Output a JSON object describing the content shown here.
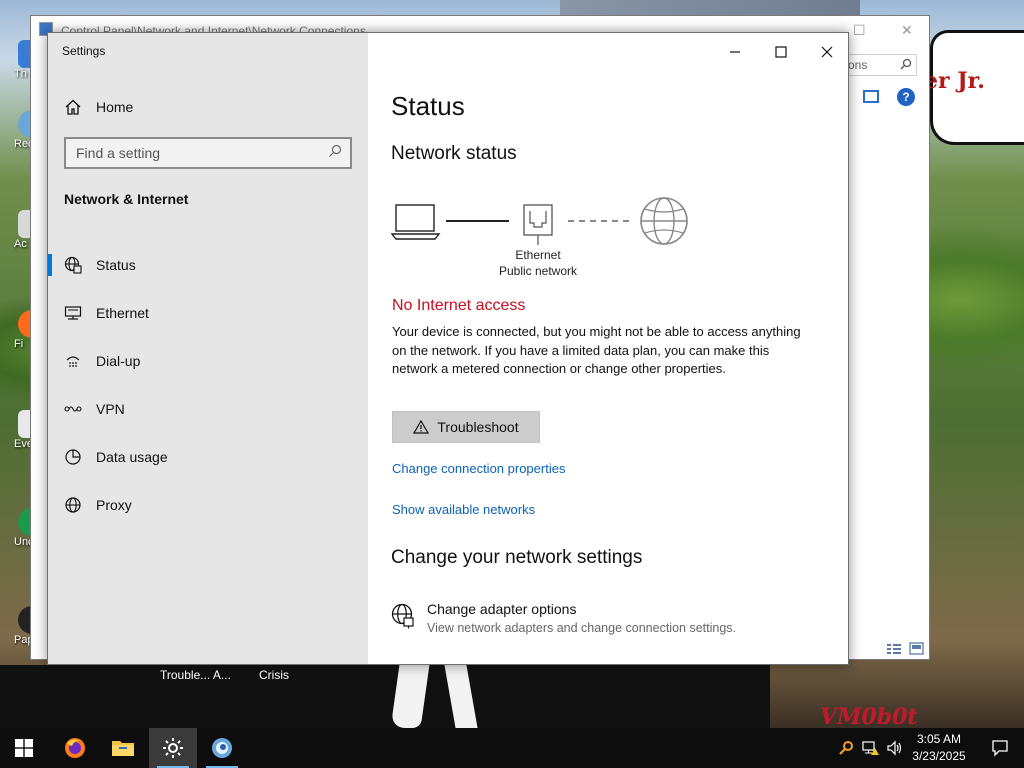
{
  "desktop": {
    "banner_text": "er Jr.",
    "watermark": "VM0b0t",
    "icons": [
      {
        "label": "Th"
      },
      {
        "label": "Rec"
      },
      {
        "label": "Ac"
      },
      {
        "label": "Fi"
      },
      {
        "label": "Eve"
      },
      {
        "label": "Unc"
      },
      {
        "label": "Papers"
      }
    ],
    "bottom_labels": [
      "Trouble... A...",
      "Crisis"
    ]
  },
  "explorer": {
    "title": "Control Panel\\Network and Internet\\Network Connections",
    "search_placeholder": "ctions",
    "help_label": "?"
  },
  "settings": {
    "window_title": "Settings",
    "home_label": "Home",
    "search_placeholder": "Find a setting",
    "section_heading": "Network & Internet",
    "nav_items": [
      {
        "label": "Status",
        "icon": "globe-status-icon",
        "active": true
      },
      {
        "label": "Ethernet",
        "icon": "ethernet-icon"
      },
      {
        "label": "Dial-up",
        "icon": "dial-up-icon"
      },
      {
        "label": "VPN",
        "icon": "vpn-icon"
      },
      {
        "label": "Data usage",
        "icon": "data-usage-icon"
      },
      {
        "label": "Proxy",
        "icon": "proxy-globe-icon"
      }
    ],
    "main": {
      "page_title": "Status",
      "network_status_heading": "Network status",
      "adapter_name": "Ethernet",
      "network_profile": "Public network",
      "alert_title": "No Internet access",
      "alert_body": "Your device is connected, but you might not be able to access anything on the network. If you have a limited data plan, you can make this network a metered connection or change other properties.",
      "troubleshoot_label": "Troubleshoot",
      "link_change_connection": "Change connection properties",
      "link_show_networks": "Show available networks",
      "change_settings_heading": "Change your network settings",
      "adapter_options_title": "Change adapter options",
      "adapter_options_subtitle": "View network adapters and change connection settings."
    }
  },
  "taskbar": {
    "apps": [
      {
        "name": "firefox",
        "icon": "firefox-icon"
      },
      {
        "name": "file-explorer",
        "icon": "folder-icon"
      },
      {
        "name": "settings",
        "icon": "settings-gear-icon",
        "active": true
      },
      {
        "name": "browser",
        "icon": "globe-app-icon"
      }
    ],
    "time": "3:05 AM",
    "date": "3/23/2025"
  },
  "colors": {
    "accent": "#0078d7",
    "alert": "#c50f1f",
    "link": "#0a63b8",
    "sidebar_bg": "#e6e6e6",
    "taskbar_bg": "#0d0d0d"
  }
}
